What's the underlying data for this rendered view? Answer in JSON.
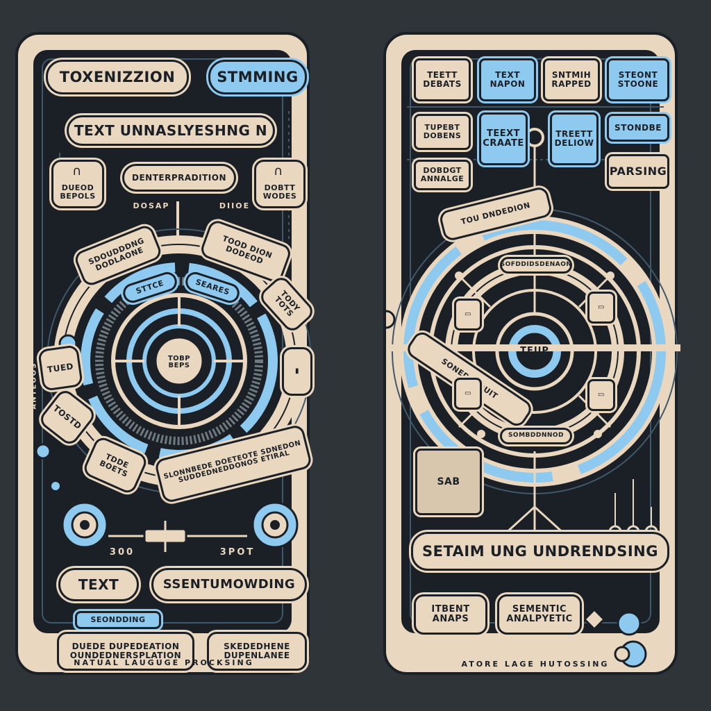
{
  "colors": {
    "background": "#2f3439",
    "cream": "#e9d7bf",
    "blue": "#8ec9f0",
    "dark": "#1b2026"
  },
  "left": {
    "top_left": "TOXENIZZION",
    "top_right": "STMMING",
    "banner": "TEXT UNNASLYESHNG N",
    "center_pill": "DENTERPRADITION",
    "side_left": "DUEOD BEPOLS",
    "side_right": "DOBTT WODES",
    "ring_top_left": "SDOUDDDNG DODLAONE",
    "ring_top_right": "TOOD DION DODEOD",
    "ring_right": "TODY TOTS",
    "ring_blue_left": "STTCE",
    "ring_blue_right": "SEARES",
    "ring_left": "TUED",
    "ring_left_lower": "TOSTD",
    "ring_bottom_left": "TDDE BOETS",
    "ring_bottom": "SLONNBEDE DOETEOTE SDNEDON SUDDEDNEDDONOS ETIRAL",
    "core": "TOBP BEPS",
    "top_tag_left": "DOSAP",
    "top_tag_right": "DIIOE",
    "slider_left": "300",
    "slider_right": "3POT",
    "bottom_text": "TEXT",
    "bottom_wide": "SSENTUMOWDING",
    "bottom_blue": "SEONDDING",
    "bottom_left": "DUEDE DUPEDEATION OUNDEDNERSPLATION",
    "bottom_right": "SKEDEDHENE DUPENLANEE",
    "footer": "NATUAL LAUGUGE PROCKSING",
    "vertical": "ANTEOOS"
  },
  "right": {
    "grid": [
      "TEETT DEBATS",
      "TEXT NAPON",
      "SNTMIH RAPPED",
      "STEONT STOONE",
      "TUPEBT DOBENS",
      "TEEXT CRAATE",
      "TREETT DELIOW",
      "STONDBE",
      "DOBDGT ANNALGE",
      "PARSING"
    ],
    "ring_arc": "TOU DNDEDION",
    "ring_arc_bottom": "SONEDUEDUIT",
    "inner_top": "SOFDDIDSDENAON",
    "inner_bottom": "SOMBDDNNOD",
    "core": "TEUP",
    "corner_text": "SAB",
    "banner": "SETAIM UNG UNDRENDSING",
    "bottom_left": "ITBENT ANAPS",
    "bottom_mid": "SEMENTIC ANALPYETIC",
    "footer": "ATORE LAGE HUTOSSING"
  }
}
